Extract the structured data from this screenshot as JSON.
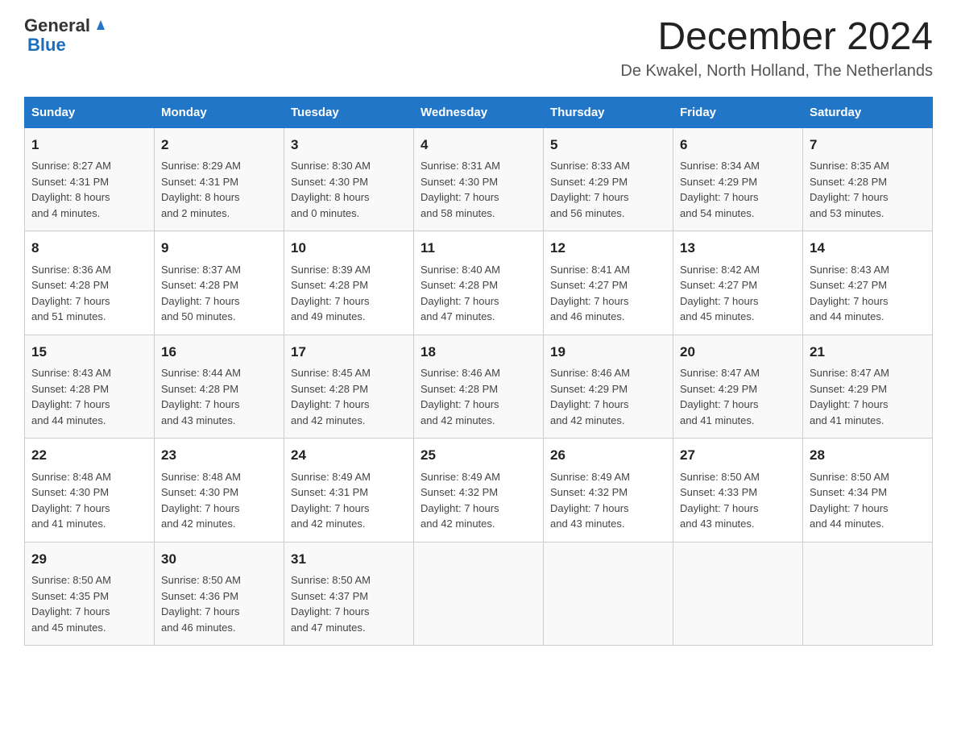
{
  "header": {
    "logo_general": "General",
    "logo_blue": "Blue",
    "month_title": "December 2024",
    "location": "De Kwakel, North Holland, The Netherlands"
  },
  "columns": [
    "Sunday",
    "Monday",
    "Tuesday",
    "Wednesday",
    "Thursday",
    "Friday",
    "Saturday"
  ],
  "weeks": [
    [
      {
        "day": "1",
        "info": "Sunrise: 8:27 AM\nSunset: 4:31 PM\nDaylight: 8 hours\nand 4 minutes."
      },
      {
        "day": "2",
        "info": "Sunrise: 8:29 AM\nSunset: 4:31 PM\nDaylight: 8 hours\nand 2 minutes."
      },
      {
        "day": "3",
        "info": "Sunrise: 8:30 AM\nSunset: 4:30 PM\nDaylight: 8 hours\nand 0 minutes."
      },
      {
        "day": "4",
        "info": "Sunrise: 8:31 AM\nSunset: 4:30 PM\nDaylight: 7 hours\nand 58 minutes."
      },
      {
        "day": "5",
        "info": "Sunrise: 8:33 AM\nSunset: 4:29 PM\nDaylight: 7 hours\nand 56 minutes."
      },
      {
        "day": "6",
        "info": "Sunrise: 8:34 AM\nSunset: 4:29 PM\nDaylight: 7 hours\nand 54 minutes."
      },
      {
        "day": "7",
        "info": "Sunrise: 8:35 AM\nSunset: 4:28 PM\nDaylight: 7 hours\nand 53 minutes."
      }
    ],
    [
      {
        "day": "8",
        "info": "Sunrise: 8:36 AM\nSunset: 4:28 PM\nDaylight: 7 hours\nand 51 minutes."
      },
      {
        "day": "9",
        "info": "Sunrise: 8:37 AM\nSunset: 4:28 PM\nDaylight: 7 hours\nand 50 minutes."
      },
      {
        "day": "10",
        "info": "Sunrise: 8:39 AM\nSunset: 4:28 PM\nDaylight: 7 hours\nand 49 minutes."
      },
      {
        "day": "11",
        "info": "Sunrise: 8:40 AM\nSunset: 4:28 PM\nDaylight: 7 hours\nand 47 minutes."
      },
      {
        "day": "12",
        "info": "Sunrise: 8:41 AM\nSunset: 4:27 PM\nDaylight: 7 hours\nand 46 minutes."
      },
      {
        "day": "13",
        "info": "Sunrise: 8:42 AM\nSunset: 4:27 PM\nDaylight: 7 hours\nand 45 minutes."
      },
      {
        "day": "14",
        "info": "Sunrise: 8:43 AM\nSunset: 4:27 PM\nDaylight: 7 hours\nand 44 minutes."
      }
    ],
    [
      {
        "day": "15",
        "info": "Sunrise: 8:43 AM\nSunset: 4:28 PM\nDaylight: 7 hours\nand 44 minutes."
      },
      {
        "day": "16",
        "info": "Sunrise: 8:44 AM\nSunset: 4:28 PM\nDaylight: 7 hours\nand 43 minutes."
      },
      {
        "day": "17",
        "info": "Sunrise: 8:45 AM\nSunset: 4:28 PM\nDaylight: 7 hours\nand 42 minutes."
      },
      {
        "day": "18",
        "info": "Sunrise: 8:46 AM\nSunset: 4:28 PM\nDaylight: 7 hours\nand 42 minutes."
      },
      {
        "day": "19",
        "info": "Sunrise: 8:46 AM\nSunset: 4:29 PM\nDaylight: 7 hours\nand 42 minutes."
      },
      {
        "day": "20",
        "info": "Sunrise: 8:47 AM\nSunset: 4:29 PM\nDaylight: 7 hours\nand 41 minutes."
      },
      {
        "day": "21",
        "info": "Sunrise: 8:47 AM\nSunset: 4:29 PM\nDaylight: 7 hours\nand 41 minutes."
      }
    ],
    [
      {
        "day": "22",
        "info": "Sunrise: 8:48 AM\nSunset: 4:30 PM\nDaylight: 7 hours\nand 41 minutes."
      },
      {
        "day": "23",
        "info": "Sunrise: 8:48 AM\nSunset: 4:30 PM\nDaylight: 7 hours\nand 42 minutes."
      },
      {
        "day": "24",
        "info": "Sunrise: 8:49 AM\nSunset: 4:31 PM\nDaylight: 7 hours\nand 42 minutes."
      },
      {
        "day": "25",
        "info": "Sunrise: 8:49 AM\nSunset: 4:32 PM\nDaylight: 7 hours\nand 42 minutes."
      },
      {
        "day": "26",
        "info": "Sunrise: 8:49 AM\nSunset: 4:32 PM\nDaylight: 7 hours\nand 43 minutes."
      },
      {
        "day": "27",
        "info": "Sunrise: 8:50 AM\nSunset: 4:33 PM\nDaylight: 7 hours\nand 43 minutes."
      },
      {
        "day": "28",
        "info": "Sunrise: 8:50 AM\nSunset: 4:34 PM\nDaylight: 7 hours\nand 44 minutes."
      }
    ],
    [
      {
        "day": "29",
        "info": "Sunrise: 8:50 AM\nSunset: 4:35 PM\nDaylight: 7 hours\nand 45 minutes."
      },
      {
        "day": "30",
        "info": "Sunrise: 8:50 AM\nSunset: 4:36 PM\nDaylight: 7 hours\nand 46 minutes."
      },
      {
        "day": "31",
        "info": "Sunrise: 8:50 AM\nSunset: 4:37 PM\nDaylight: 7 hours\nand 47 minutes."
      },
      {
        "day": "",
        "info": ""
      },
      {
        "day": "",
        "info": ""
      },
      {
        "day": "",
        "info": ""
      },
      {
        "day": "",
        "info": ""
      }
    ]
  ]
}
